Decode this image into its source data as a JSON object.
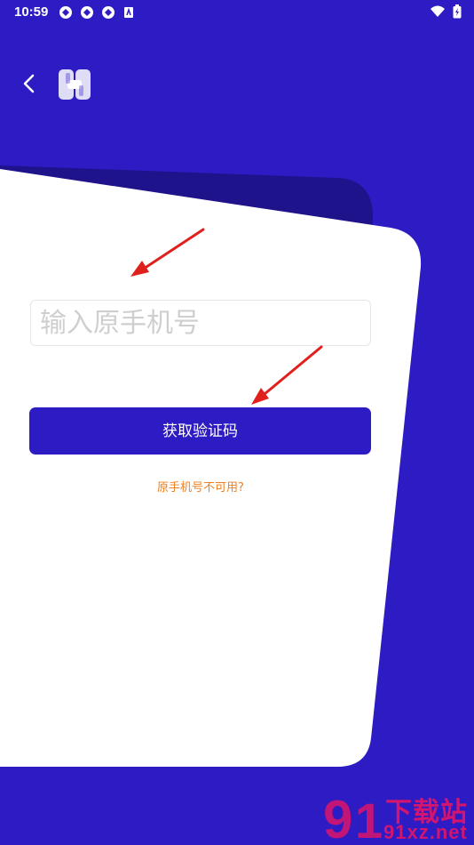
{
  "status_bar": {
    "time": "10:59"
  },
  "login": {
    "phone_placeholder": "输入原手机号",
    "get_code_label": "获取验证码",
    "help_link": "原手机号不可用?"
  },
  "watermark": {
    "title": "下载站",
    "url": "91xz.net"
  },
  "colors": {
    "brand": "#2d1bc3",
    "link": "#f07f1f",
    "annotation_arrow": "#e0201c"
  }
}
